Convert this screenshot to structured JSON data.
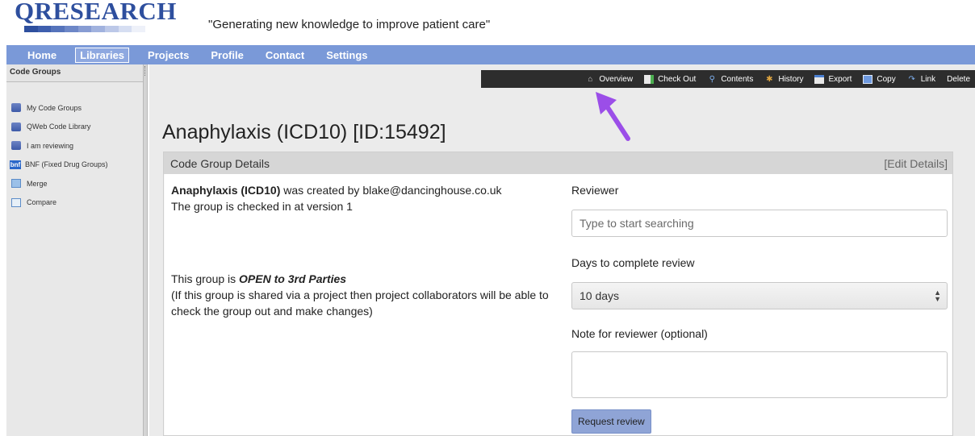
{
  "header": {
    "logo_text": "QRESEARCH",
    "tagline": "\"Generating new knowledge to improve patient care\""
  },
  "nav": {
    "items": [
      {
        "label": "Home"
      },
      {
        "label": "Libraries"
      },
      {
        "label": "Projects"
      },
      {
        "label": "Profile"
      },
      {
        "label": "Contact"
      },
      {
        "label": "Settings"
      }
    ],
    "active": "Libraries"
  },
  "sidebar": {
    "title": "Code Groups",
    "items": [
      {
        "label": "My Code Groups",
        "icon": "database-icon"
      },
      {
        "label": "QWeb Code Library",
        "icon": "database-icon"
      },
      {
        "label": "I am reviewing",
        "icon": "database-icon"
      },
      {
        "label": "BNF (Fixed Drug Groups)",
        "icon": "bnf-icon",
        "icon_text": "bnf"
      },
      {
        "label": "Merge",
        "icon": "merge-icon"
      },
      {
        "label": "Compare",
        "icon": "compare-icon"
      }
    ]
  },
  "toolbar": {
    "items": [
      {
        "label": "Overview",
        "icon": "home-icon"
      },
      {
        "label": "Check Out",
        "icon": "checkout-icon"
      },
      {
        "label": "Contents",
        "icon": "search-icon"
      },
      {
        "label": "History",
        "icon": "history-icon"
      },
      {
        "label": "Export",
        "icon": "export-icon"
      },
      {
        "label": "Copy",
        "icon": "copy-icon"
      },
      {
        "label": "Link",
        "icon": "link-icon"
      },
      {
        "label": "Delete",
        "icon": ""
      }
    ]
  },
  "page": {
    "title": "Anaphylaxis (ICD10) [ID:15492]"
  },
  "panel": {
    "header": "Code Group Details",
    "edit_label": "[Edit Details]",
    "created_name": "Anaphylaxis (ICD10)",
    "created_rest": " was created by blake@dancinghouse.co.uk",
    "version_line": "The group is checked in at version 1",
    "open_prefix": "This group is ",
    "open_status": "OPEN to 3rd Parties",
    "open_note": "(If this group is shared via a project then project collaborators will be able to check the group out and make changes)"
  },
  "review": {
    "reviewer_label": "Reviewer",
    "reviewer_placeholder": "Type to start searching",
    "days_label": "Days to complete review",
    "days_value": "10 days",
    "note_label": "Note for reviewer (optional)",
    "request_button": "Request review"
  },
  "colors": {
    "nav_bg": "#7a99d8",
    "toolbar_bg": "#2d2d2d",
    "arrow": "#9b4ee8",
    "button_bg": "#8fa4d6"
  }
}
